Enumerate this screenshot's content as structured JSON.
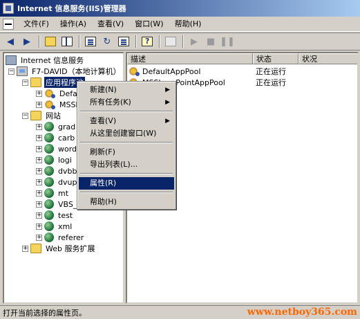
{
  "window": {
    "title": "Internet 信息服务(IIS)管理器"
  },
  "menubar": {
    "items": [
      "文件(F)",
      "操作(A)",
      "查看(V)",
      "窗口(W)",
      "帮助(H)"
    ]
  },
  "toolbar": {
    "buttons": [
      "back-icon",
      "forward-icon",
      "up-folder-icon",
      "show-hide-tree-icon",
      "properties-icon",
      "refresh-icon",
      "export-list-icon",
      "help-icon",
      "computer-icon",
      "play-icon",
      "stop-icon",
      "pause-icon"
    ]
  },
  "tree": {
    "root": "Internet 信息服务",
    "computer": "F7-DAVID（本地计算机）",
    "app_pools": "应用程序池",
    "pool_children": [
      "DefaultAppPool",
      "MSSharePointAppPool"
    ],
    "pool_children_visible": [
      "Defa",
      "MSSh"
    ],
    "websites": "网站",
    "sites": [
      "grad",
      "carb",
      "word",
      "logi",
      "dvbb",
      "dvup",
      "mt",
      "VBS_",
      "test",
      "xml",
      "referer"
    ],
    "web_ext": "Web 服务扩展"
  },
  "list": {
    "columns": [
      "描述",
      "状态",
      "状况"
    ],
    "rows": [
      {
        "name": "DefaultAppPool",
        "status": "正在运行",
        "condition": ""
      },
      {
        "name": "MSSharePointAppPool",
        "status": "正在运行",
        "condition": ""
      }
    ]
  },
  "context_menu": {
    "items": [
      {
        "label": "新建(N)",
        "submenu": true
      },
      {
        "label": "所有任务(K)",
        "submenu": true
      },
      {
        "label": "查看(V)",
        "submenu": true
      },
      {
        "label": "从这里创建窗口(W)",
        "submenu": false
      },
      {
        "label": "刷新(F)",
        "submenu": false
      },
      {
        "label": "导出列表(L)...",
        "submenu": false
      },
      {
        "label": "属性(R)",
        "submenu": false,
        "highlighted": true
      },
      {
        "label": "帮助(H)",
        "submenu": false
      }
    ],
    "arrow": "▶"
  },
  "status": {
    "text": "打开当前选择的属性页。",
    "watermark": "www.netboy365.com"
  },
  "colors": {
    "title_start": "#0a246a",
    "title_end": "#a6caf0",
    "highlight": "#0a246a",
    "watermark": "#ff6600"
  },
  "tree_expanders": {
    "minus": "−",
    "plus": "+"
  }
}
